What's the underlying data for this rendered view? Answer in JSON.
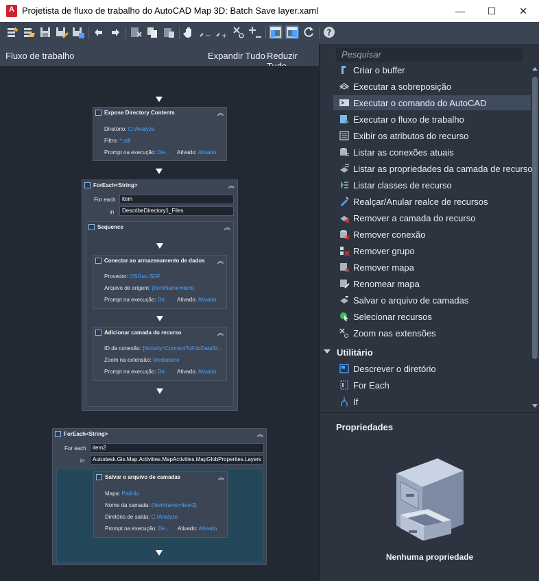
{
  "window": {
    "app_icon_letter": "A",
    "title": "Projetista de fluxo de trabalho do AutoCAD Map 3D: Batch Save layer.xaml",
    "minimize": "—",
    "maximize": "☐",
    "close": "✕"
  },
  "toolbar": {
    "buttons": [
      "new-icon",
      "open-icon",
      "save-icon",
      "save-as-icon",
      "export-icon",
      "undo-icon",
      "redo-icon",
      "cut-icon",
      "copy-icon",
      "paste-icon",
      "pan-icon",
      "zoom-out-icon",
      "zoom-in-icon",
      "zoom-fit-icon",
      "zoom-reset-icon",
      "layout-vertical-icon",
      "layout-horizontal-icon",
      "refresh-icon",
      "help-icon"
    ]
  },
  "workflow": {
    "header": "Fluxo de trabalho",
    "expand_all": "Expandir Tudo",
    "collapse_all": "Reduzir Tudo",
    "expose_directory": {
      "title": "Expose Directory Contents",
      "dir_label": "Diretório:",
      "dir_value": "C:\\Analyze",
      "filter_label": "Filtro:",
      "filter_value": "*.sdf",
      "prompt_label": "Prompt na execução:",
      "prompt_value": "De...",
      "enabled_label": "Ativado:",
      "enabled_value": "Ativado"
    },
    "foreach1": {
      "title": "ForEach<String>",
      "foreach_label": "For each",
      "foreach_value": "item",
      "in_label": "in",
      "in_value": "DescribeDirectory1_Files",
      "sequence_title": "Sequence",
      "connect": {
        "title": "Conectar ao armazenamento de dados",
        "provider_label": "Provedor:",
        "provider_value": "OSGeo.SDF",
        "source_label": "Arquivo de origem:",
        "source_value": "{ItemName=item}",
        "prompt_label": "Prompt na execução:",
        "prompt_value": "De...",
        "enabled_label": "Ativado:",
        "enabled_value": "Ativado"
      },
      "add_layer": {
        "title": "Adicionar camada do recurso",
        "conn_label": "ID da conexão:",
        "conn_value": "{Activity=ConnectToFdoDataSt...",
        "zoom_label": "Zoom na extensão:",
        "zoom_value": "Verdadeiro",
        "prompt_label": "Prompt na execução:",
        "prompt_value": "De...",
        "enabled_label": "Ativado:",
        "enabled_value": "Ativado"
      }
    },
    "foreach2": {
      "title": "ForEach<String>",
      "foreach_label": "For each",
      "foreach_value": "item2",
      "in_label": "in",
      "in_value": "Autodesk.Gis.Map.Activities.MapActivities.MapGlobProperties.Layers",
      "save_layer": {
        "title": "Salvar o arquivo de camadas",
        "map_label": "Mapa:",
        "map_value": "Padrão",
        "layer_label": "Nome da camada:",
        "layer_value": "{ItemName=item2}",
        "out_label": "Diretório de saída:",
        "out_value": "C:\\Analyze",
        "prompt_label": "Prompt na execução:",
        "prompt_value": "De...",
        "enabled_label": "Ativado:",
        "enabled_value": "Ativado"
      }
    }
  },
  "tools": {
    "search_placeholder": "Pesquisar",
    "items": [
      {
        "label": "Criar o buffer",
        "icon": "buffer-icon"
      },
      {
        "label": "Executar a sobreposição",
        "icon": "overlay-icon"
      },
      {
        "label": "Executar o comando do AutoCAD",
        "icon": "command-icon"
      },
      {
        "label": "Executar o fluxo de trabalho",
        "icon": "run-workflow-icon"
      },
      {
        "label": "Exibir os atributos do recurso",
        "icon": "attributes-icon"
      },
      {
        "label": "Listar as conexões atuais",
        "icon": "list-connections-icon"
      },
      {
        "label": "Listar as propriedades da camada de recurso",
        "icon": "layer-properties-icon"
      },
      {
        "label": "Listar classes de recurso",
        "icon": "feature-classes-icon"
      },
      {
        "label": "Realçar/Anular realce de recursos",
        "icon": "highlight-icon"
      },
      {
        "label": "Remover a camada do recurso",
        "icon": "remove-layer-icon"
      },
      {
        "label": "Remover conexão",
        "icon": "remove-connection-icon"
      },
      {
        "label": "Remover grupo",
        "icon": "remove-group-icon"
      },
      {
        "label": "Remover mapa",
        "icon": "remove-map-icon"
      },
      {
        "label": "Renomear mapa",
        "icon": "rename-map-icon"
      },
      {
        "label": "Salvar o arquivo de camadas",
        "icon": "save-layer-icon"
      },
      {
        "label": "Selecionar recursos",
        "icon": "select-features-icon"
      },
      {
        "label": "Zoom nas extensões",
        "icon": "zoom-extents-icon"
      }
    ],
    "selected_index": 2,
    "category": "Utilitário",
    "utility_items": [
      {
        "label": "Descrever o diretório",
        "icon": "describe-directory-icon"
      },
      {
        "label": "For Each",
        "icon": "foreach-icon"
      },
      {
        "label": "If",
        "icon": "if-icon"
      }
    ]
  },
  "properties": {
    "title": "Propriedades",
    "empty": "Nenhuma propriedade"
  },
  "colors": {
    "accent_link": "#4aa3ff",
    "canvas_bg": "#222933",
    "panel_bg": "#2d3440",
    "toolbar_bg": "#3b4453",
    "selection": "#3f4c5d"
  }
}
